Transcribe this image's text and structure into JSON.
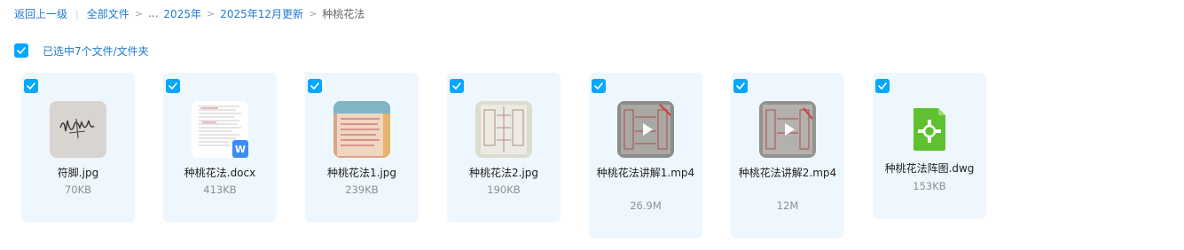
{
  "breadcrumb": {
    "back": "返回上一级",
    "all_files": "全部文件",
    "ellipsis": "...",
    "folder1": "2025年",
    "folder2": "2025年12月更新",
    "current": "种桃花法"
  },
  "selection": {
    "label": "已选中7个文件/文件夹"
  },
  "files": [
    {
      "name": "符脚.jpg",
      "size": "70KB"
    },
    {
      "name": "种桃花法.docx",
      "size": "413KB"
    },
    {
      "name": "种桃花法1.jpg",
      "size": "239KB"
    },
    {
      "name": "种桃花法2.jpg",
      "size": "190KB"
    },
    {
      "name": "种桃花法讲解1.mp4",
      "size": "26.9M"
    },
    {
      "name": "种桃花法讲解2.mp4",
      "size": "12M"
    },
    {
      "name": "种桃花法阵图.dwg",
      "size": "153KB"
    }
  ],
  "icons": {
    "checkbox": "check-icon",
    "word": "word-doc-icon",
    "dwg": "dwg-file-icon",
    "video": "play-icon"
  },
  "colors": {
    "accent": "#06a7ff",
    "link": "#1f7ad1",
    "tile_bg": "#eef7fd",
    "dwg": "#5fc12f",
    "word_badge": "#3d8bf8"
  }
}
